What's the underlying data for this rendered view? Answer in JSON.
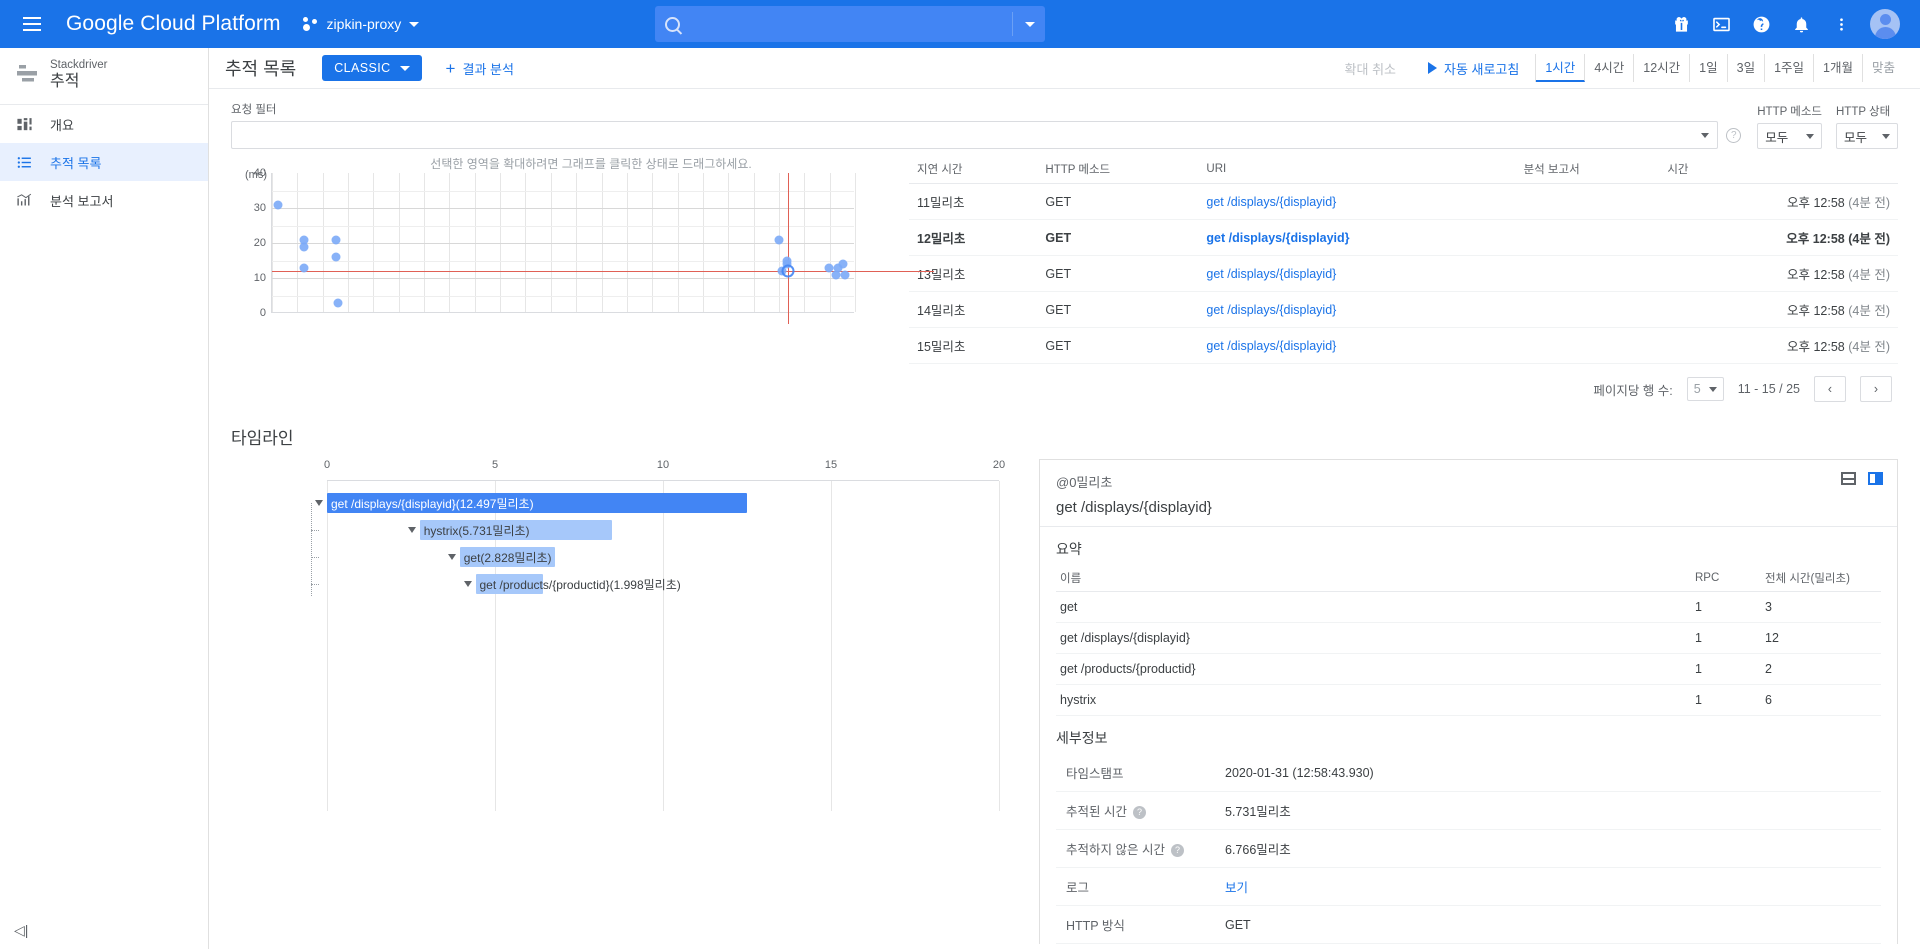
{
  "topbar": {
    "menu_icon": "hamburger-icon",
    "brand": "Google Cloud Platform",
    "project": "zipkin-proxy",
    "search_placeholder": "",
    "icons": [
      "gift-icon",
      "terminal-icon",
      "help-icon",
      "notifications-icon",
      "more-vert-icon",
      "avatar"
    ]
  },
  "sidebar": {
    "product_line1": "Stackdriver",
    "product_line2": "추적",
    "items": [
      {
        "label": "개요",
        "icon": "dashboard-icon",
        "selected": false
      },
      {
        "label": "추적 목록",
        "icon": "list-icon",
        "selected": true
      },
      {
        "label": "분석 보고서",
        "icon": "analytics-icon",
        "selected": false
      }
    ],
    "collapse_label": "◁|"
  },
  "page": {
    "title": "추적 목록",
    "classic_button": "CLASSIC",
    "analyze_link": "결과 분석",
    "zoom_cancel": "확대 취소",
    "auto_refresh": "자동 새로고침",
    "ranges": [
      {
        "label": "1시간",
        "active": true
      },
      {
        "label": "4시간",
        "active": false
      },
      {
        "label": "12시간",
        "active": false
      },
      {
        "label": "1일",
        "active": false
      },
      {
        "label": "3일",
        "active": false
      },
      {
        "label": "1주일",
        "active": false
      },
      {
        "label": "1개월",
        "active": false
      },
      {
        "label": "맞춤",
        "active": false,
        "dim": true
      }
    ]
  },
  "filter": {
    "label": "요청 필터",
    "value": "",
    "placeholder": "",
    "http_method_label": "HTTP 메소드",
    "http_method_value": "모두",
    "http_status_label": "HTTP 상태",
    "http_status_value": "모두"
  },
  "chart_data": {
    "type": "scatter",
    "title": "",
    "hint": "선택한 영역을 확대하려면 그래프를 클릭한 상태로 드래그하세요.",
    "ylabel": "(ms)",
    "ylim": [
      0,
      40
    ],
    "yticks": [
      0,
      10,
      20,
      30,
      40
    ],
    "xlim": [
      0,
      100
    ],
    "grid": true,
    "crosshair": {
      "x": 88.5,
      "y": 12
    },
    "points": [
      {
        "x": 1.0,
        "y": 31
      },
      {
        "x": 5.5,
        "y": 21
      },
      {
        "x": 5.5,
        "y": 19
      },
      {
        "x": 5.5,
        "y": 13
      },
      {
        "x": 11.0,
        "y": 21
      },
      {
        "x": 11.0,
        "y": 16
      },
      {
        "x": 11.3,
        "y": 3
      },
      {
        "x": 87.0,
        "y": 21
      },
      {
        "x": 88.3,
        "y": 15
      },
      {
        "x": 88.4,
        "y": 14
      },
      {
        "x": 87.4,
        "y": 12
      },
      {
        "x": 88.5,
        "y": 12,
        "selected": true
      },
      {
        "x": 95.5,
        "y": 13
      },
      {
        "x": 97.0,
        "y": 13
      },
      {
        "x": 98.0,
        "y": 14
      },
      {
        "x": 96.8,
        "y": 11
      },
      {
        "x": 98.3,
        "y": 11
      }
    ]
  },
  "trace_table": {
    "headers": [
      "지연 시간",
      "HTTP 메소드",
      "URI",
      "분석 보고서",
      "시간"
    ],
    "rows": [
      {
        "latency": "11밀리초",
        "method": "GET",
        "uri": "get /displays/{displayid}",
        "report": "",
        "time": "오후 12:58",
        "ago": "(4분 전)",
        "bold": false
      },
      {
        "latency": "12밀리초",
        "method": "GET",
        "uri": "get /displays/{displayid}",
        "report": "",
        "time": "오후 12:58",
        "ago": "(4분 전)",
        "bold": true
      },
      {
        "latency": "13밀리초",
        "method": "GET",
        "uri": "get /displays/{displayid}",
        "report": "",
        "time": "오후 12:58",
        "ago": "(4분 전)",
        "bold": false
      },
      {
        "latency": "14밀리초",
        "method": "GET",
        "uri": "get /displays/{displayid}",
        "report": "",
        "time": "오후 12:58",
        "ago": "(4분 전)",
        "bold": false
      },
      {
        "latency": "15밀리초",
        "method": "GET",
        "uri": "get /displays/{displayid}",
        "report": "",
        "time": "오후 12:58",
        "ago": "(4분 전)",
        "bold": false
      }
    ],
    "pager": {
      "rows_label": "페이지당 행 수:",
      "rows_value": "5",
      "range": "11 - 15 / 25",
      "prev": "‹",
      "next": "›"
    }
  },
  "timeline": {
    "title": "타임라인",
    "axis_ticks": [
      "0",
      "5",
      "10",
      "15",
      "20"
    ],
    "axis_max": 20,
    "spans": [
      {
        "label": "get /displays/{displayid}(12.497밀리초)",
        "start": 0.0,
        "duration": 12.497,
        "level": 0
      },
      {
        "label": "hystrix(5.731밀리초)",
        "start": 2.76,
        "duration": 5.731,
        "level": 1
      },
      {
        "label": "get(2.828밀리초)",
        "start": 3.95,
        "duration": 2.828,
        "level": 2
      },
      {
        "label": "get /products/{productid}(1.998밀리초)",
        "start": 4.42,
        "duration": 1.998,
        "level": 3
      }
    ]
  },
  "detail": {
    "at_label": "@0밀리초",
    "span_name": "get /displays/{displayid}",
    "summary_title": "요약",
    "summary_headers": [
      "이름",
      "RPC",
      "전체 시간(밀리초)"
    ],
    "summary_rows": [
      {
        "name": "get",
        "rpc": "1",
        "total": "3"
      },
      {
        "name": "get /displays/{displayid}",
        "rpc": "1",
        "total": "12"
      },
      {
        "name": "get /products/{productid}",
        "rpc": "1",
        "total": "2"
      },
      {
        "name": "hystrix",
        "rpc": "1",
        "total": "6"
      }
    ],
    "details_title": "세부정보",
    "details_rows": [
      {
        "key": "타임스탬프",
        "value": "2020-01-31 (12:58:43.930)",
        "help": false,
        "link": false
      },
      {
        "key": "추적된 시간",
        "value": "5.731밀리초",
        "help": true,
        "link": false
      },
      {
        "key": "추적하지 않은 시간",
        "value": "6.766밀리초",
        "help": true,
        "link": false
      },
      {
        "key": "로그",
        "value": "보기",
        "help": false,
        "link": true
      },
      {
        "key": "HTTP 방식",
        "value": "GET",
        "help": false,
        "link": false
      }
    ],
    "icons": [
      "split-view-icon",
      "side-panel-icon"
    ]
  },
  "colors": {
    "brand_blue": "#1a73e8",
    "span_root": "#4285f4",
    "span_child": "#a6c8fa",
    "crosshair": "#e06055",
    "point": "#7baaf7"
  }
}
